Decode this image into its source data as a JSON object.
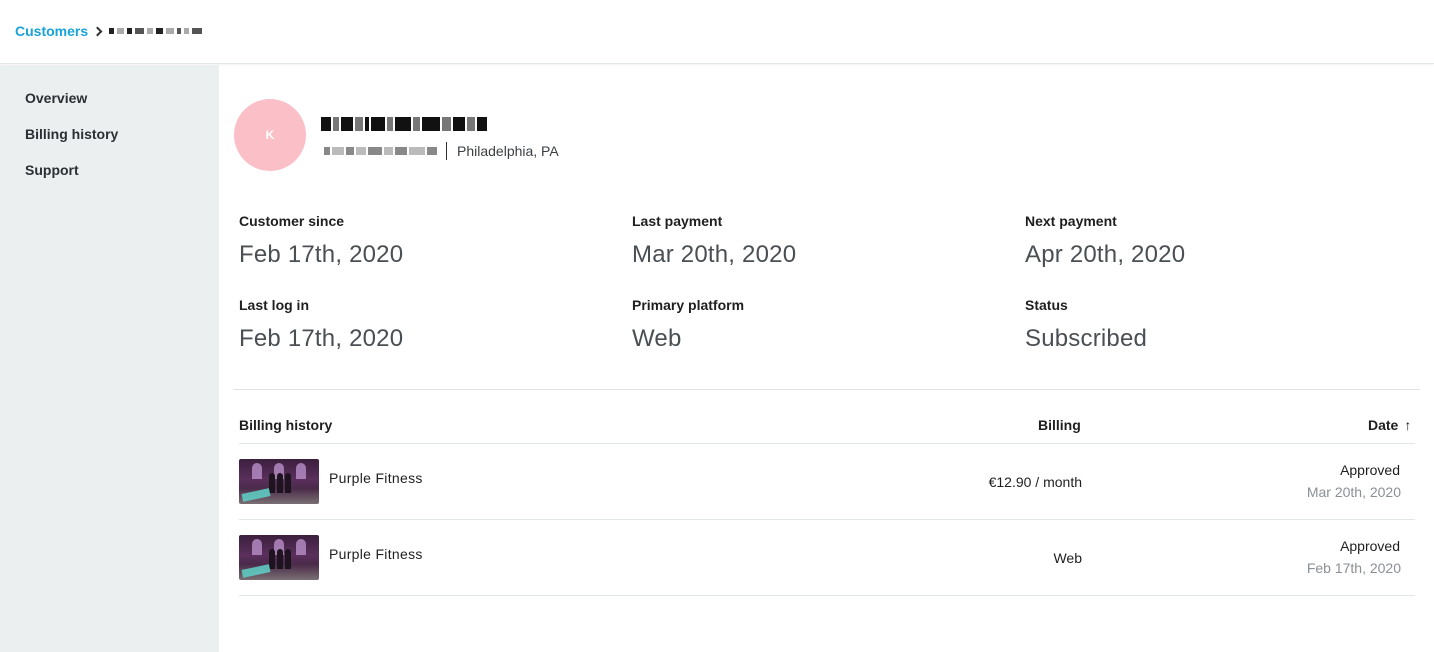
{
  "breadcrumb": {
    "root": "Customers"
  },
  "sidebar": {
    "items": [
      {
        "label": "Overview"
      },
      {
        "label": "Billing history"
      },
      {
        "label": "Support"
      }
    ]
  },
  "profile": {
    "avatar_initial": "K",
    "avatar_color": "#fbbfc8",
    "location": "Philadelphia, PA"
  },
  "stats": [
    {
      "label": "Customer since",
      "value": "Feb 17th, 2020"
    },
    {
      "label": "Last payment",
      "value": "Mar 20th, 2020"
    },
    {
      "label": "Next payment",
      "value": "Apr 20th, 2020"
    },
    {
      "label": "Last log in",
      "value": "Feb 17th, 2020"
    },
    {
      "label": "Primary platform",
      "value": "Web"
    },
    {
      "label": "Status",
      "value": "Subscribed"
    }
  ],
  "billing_table": {
    "headers": {
      "product": "Billing history",
      "billing": "Billing",
      "date": "Date",
      "date_sort_icon": "↑"
    },
    "rows": [
      {
        "product": "Purple Fitness",
        "billing": "€12.90 / month",
        "status": "Approved",
        "date": "Mar 20th, 2020"
      },
      {
        "product": "Purple Fitness",
        "billing": "Web",
        "status": "Approved",
        "date": "Feb 17th, 2020"
      }
    ]
  },
  "colors": {
    "accent": "#1aa3d9",
    "sidebar_bg": "#eceff0",
    "muted_text": "#8a9096"
  }
}
